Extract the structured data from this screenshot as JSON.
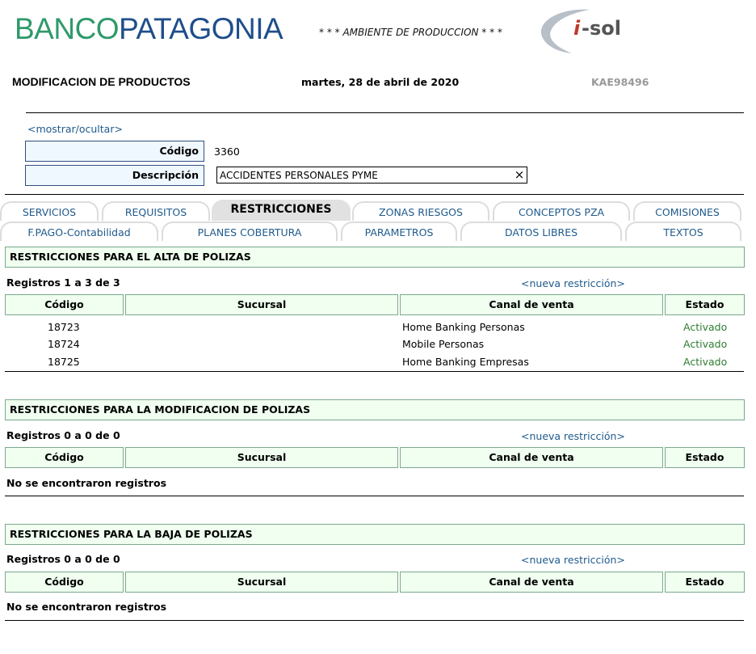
{
  "header": {
    "logo_part1": "BANCO",
    "logo_part2": "PATAGONIA",
    "ambiente": "* * * AMBIENTE DE PRODUCCION * * *",
    "isol_logo": "i-sol",
    "page_title": "MODIFICACION DE PRODUCTOS",
    "date": "martes, 28 de abril de 2020",
    "user": "KAE98496"
  },
  "form": {
    "toggle_link": "<mostrar/ocultar>",
    "codigo_label": "Código",
    "codigo_value": "3360",
    "descripcion_label": "Descripción",
    "descripcion_value": "ACCIDENTES PERSONALES PYME",
    "clear_icon": "×"
  },
  "tabs_row1": [
    "SERVICIOS",
    "REQUISITOS",
    "RESTRICCIONES",
    "ZONAS RIESGOS",
    "CONCEPTOS PZA",
    "COMISIONES"
  ],
  "tabs_row2": [
    "F.PAGO-Contabilidad",
    "PLANES COBERTURA",
    "PARAMETROS",
    "DATOS LIBRES",
    "TEXTOS"
  ],
  "columns": [
    "Código",
    "Sucursal",
    "Canal de venta",
    "Estado"
  ],
  "new_link": "<nueva restricción>",
  "no_records": "No se encontraron registros",
  "sections": [
    {
      "title": "RESTRICCIONES PARA EL ALTA DE POLIZAS",
      "registros": "Registros 1 a 3 de 3",
      "rows": [
        {
          "codigo": "18723",
          "sucursal": "",
          "canal": "Home Banking Personas",
          "estado": "Activado"
        },
        {
          "codigo": "18724",
          "sucursal": "",
          "canal": "Mobile Personas",
          "estado": "Activado"
        },
        {
          "codigo": "18725",
          "sucursal": "",
          "canal": "Home Banking Empresas",
          "estado": "Activado"
        }
      ]
    },
    {
      "title": "RESTRICCIONES PARA LA MODIFICACION DE POLIZAS",
      "registros": "Registros 0 a 0 de 0",
      "rows": []
    },
    {
      "title": "RESTRICCIONES PARA LA BAJA DE POLIZAS",
      "registros": "Registros 0 a 0 de 0",
      "rows": []
    }
  ],
  "colors": {
    "brand_green": "#2e9a6b",
    "brand_blue": "#1f4e8c",
    "link": "#1f5a8c",
    "status_active": "#2e7d32",
    "header_bg": "#f0fff0"
  }
}
